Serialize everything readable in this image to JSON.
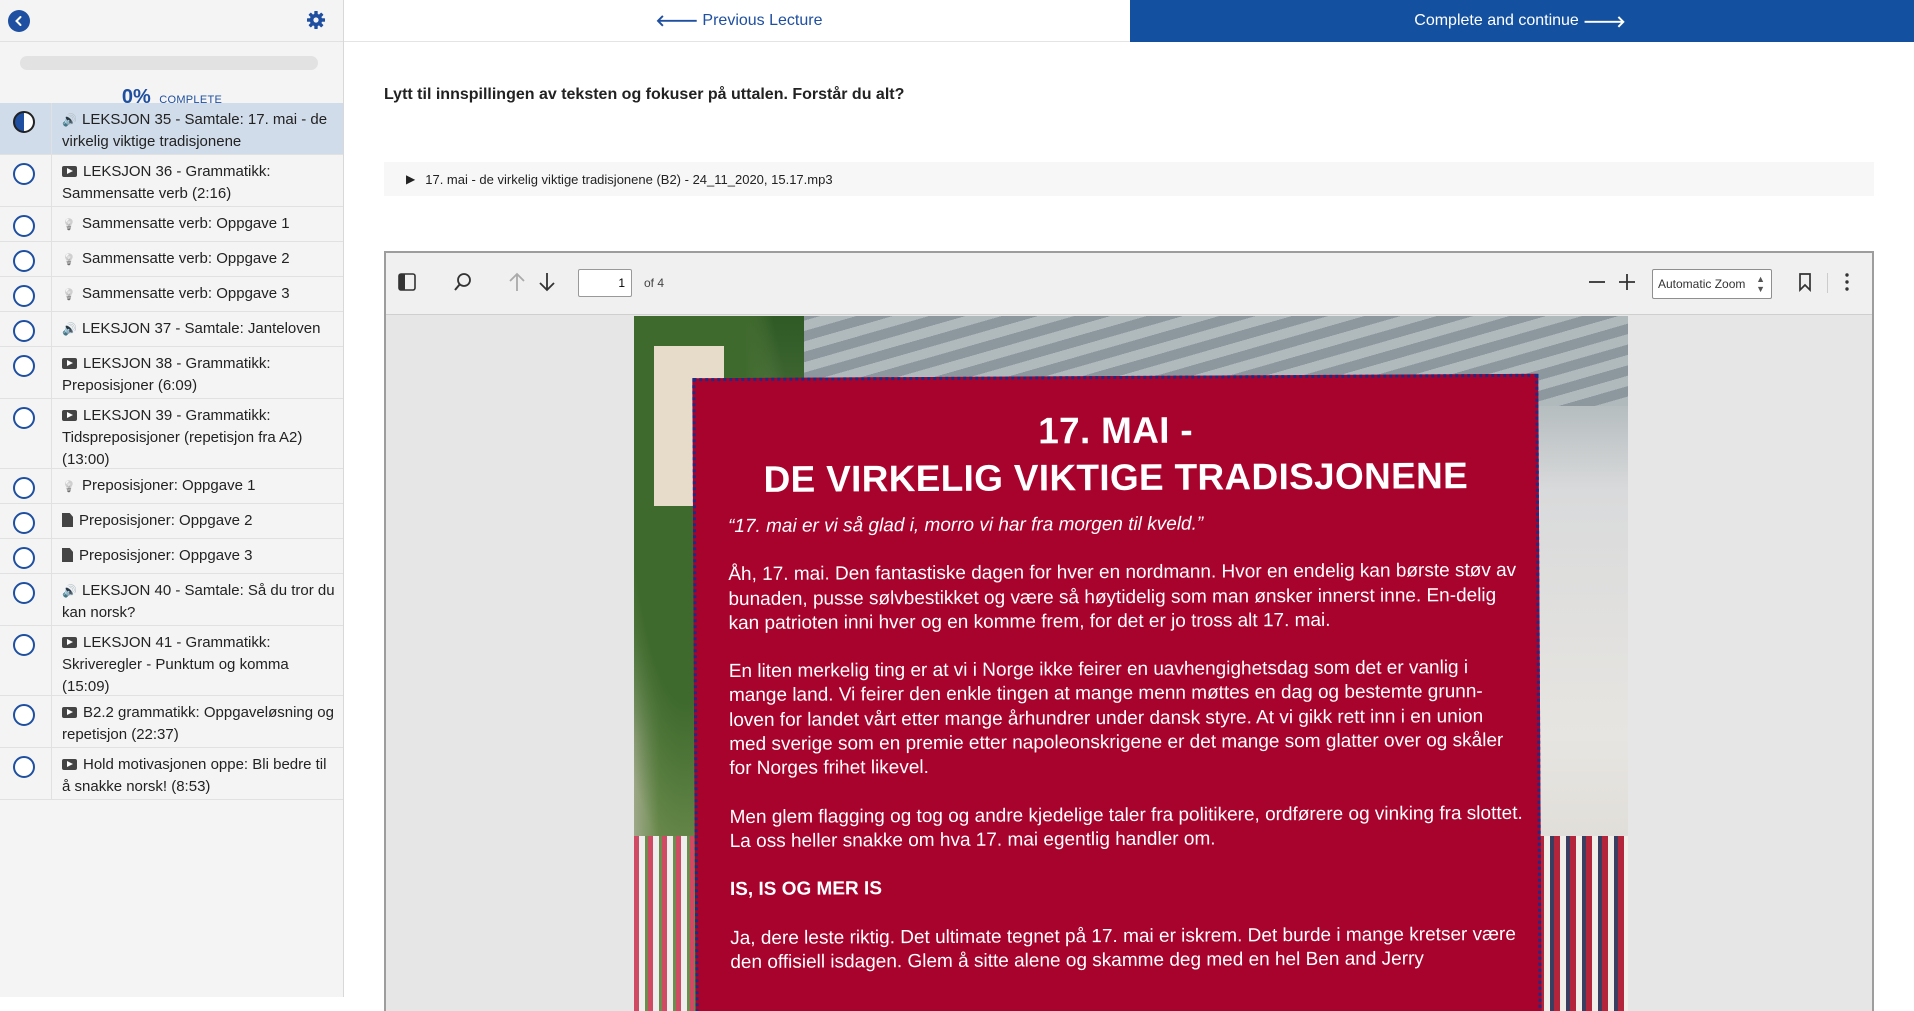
{
  "sidebar": {
    "progress": {
      "percent": "0%",
      "label": "COMPLETE",
      "fraction": 0.0
    },
    "items": [
      {
        "title": "LEKSJON 35 - Samtale: 17. mai - de virkelig viktige tradisjonene",
        "icon": "speaker-icon",
        "status": "in-progress",
        "active": true
      },
      {
        "title": "LEKSJON 36 - Grammatikk: Sammensatte verb (2:16)",
        "icon": "video-icon",
        "status": "not-started"
      },
      {
        "title": "Sammensatte verb: Oppgave 1",
        "icon": "lightbulb-icon",
        "status": "not-started"
      },
      {
        "title": "Sammensatte verb: Oppgave 2",
        "icon": "lightbulb-icon",
        "status": "not-started"
      },
      {
        "title": "Sammensatte verb: Oppgave 3",
        "icon": "lightbulb-icon",
        "status": "not-started"
      },
      {
        "title": "LEKSJON 37 - Samtale: Janteloven",
        "icon": "speaker-icon",
        "status": "not-started"
      },
      {
        "title": "LEKSJON 38 - Grammatikk: Preposisjoner (6:09)",
        "icon": "video-icon",
        "status": "not-started"
      },
      {
        "title": "LEKSJON 39 - Grammatikk: Tidspreposisjoner (repetisjon fra A2) (13:00)",
        "icon": "video-icon",
        "status": "not-started"
      },
      {
        "title": "Preposisjoner: Oppgave 1",
        "icon": "lightbulb-icon",
        "status": "not-started"
      },
      {
        "title": "Preposisjoner: Oppgave 2",
        "icon": "document-icon",
        "status": "not-started"
      },
      {
        "title": "Preposisjoner: Oppgave 3",
        "icon": "document-icon",
        "status": "not-started"
      },
      {
        "title": "LEKSJON 40 - Samtale: Så du tror du kan norsk?",
        "icon": "speaker-icon",
        "status": "not-started"
      },
      {
        "title": "LEKSJON 41 - Grammatikk: Skriveregler - Punktum og komma (15:09)",
        "icon": "video-icon",
        "status": "not-started"
      },
      {
        "title": "B2.2 grammatikk: Oppgaveløsning og repetisjon (22:37)",
        "icon": "video-icon",
        "status": "not-started"
      },
      {
        "title": "Hold motivasjonen oppe: Bli bedre til å snakke norsk! (8:53)",
        "icon": "video-icon",
        "status": "not-started"
      }
    ]
  },
  "nav": {
    "prev_label": "Previous Lecture",
    "next_label": "Complete and continue"
  },
  "lecture": {
    "instruction": "Lytt til innspillingen av teksten og fokuser på uttalen. Forstår du alt?",
    "audio_file": "17. mai - de virkelig viktige tradisjonene (B2) - 24_11_2020, 15.17.mp3"
  },
  "pdf_viewer": {
    "page_number": "1",
    "page_of": "of 4",
    "zoom": "Automatic Zoom",
    "document": {
      "title_line1": "17. MAI -",
      "title_line2": "DE VIRKELIG VIKTIGE TRADISJONENE",
      "quote": "“17. mai er vi så glad i, morro vi har fra morgen til kveld.”",
      "p1": "Åh, 17. mai. Den fantastiske dagen for hver en nordmann. Hvor en endelig kan børste støv av bunaden, pusse sølvbestikket og være så høytidelig som man ønsker innerst inne. En-delig kan patrioten inni hver og en komme frem, for det er jo tross alt 17. mai.",
      "p2": "En liten merkelig ting er at vi i Norge ikke feirer en uavhengighetsdag som det er vanlig i mange land. Vi feirer den enkle tingen at mange menn møttes en dag og bestemte grunn-loven for landet vårt etter mange århundrer under dansk styre. At vi gikk rett inn i en union med sverige som en premie etter napoleonskrigene er det mange som glatter over og skåler for Norges frihet likevel.",
      "p3": "Men glem flagging og tog og andre kjedelige taler fra politikere, ordførere og vinking fra slottet. La oss heller snakke om hva 17. mai egentlig handler om.",
      "heading": "IS, IS OG MER IS",
      "p4": "Ja, dere leste riktig. Det ultimate tegnet på 17. mai er iskrem. Det burde i mange kretser være den offisiell isdagen. Glem å sitte alene og skamme deg med en hel Ben and Jerry"
    }
  },
  "colors": {
    "brand_blue": "#1350a0",
    "card_red": "#a8032d",
    "active_row": "#d1dcea"
  }
}
